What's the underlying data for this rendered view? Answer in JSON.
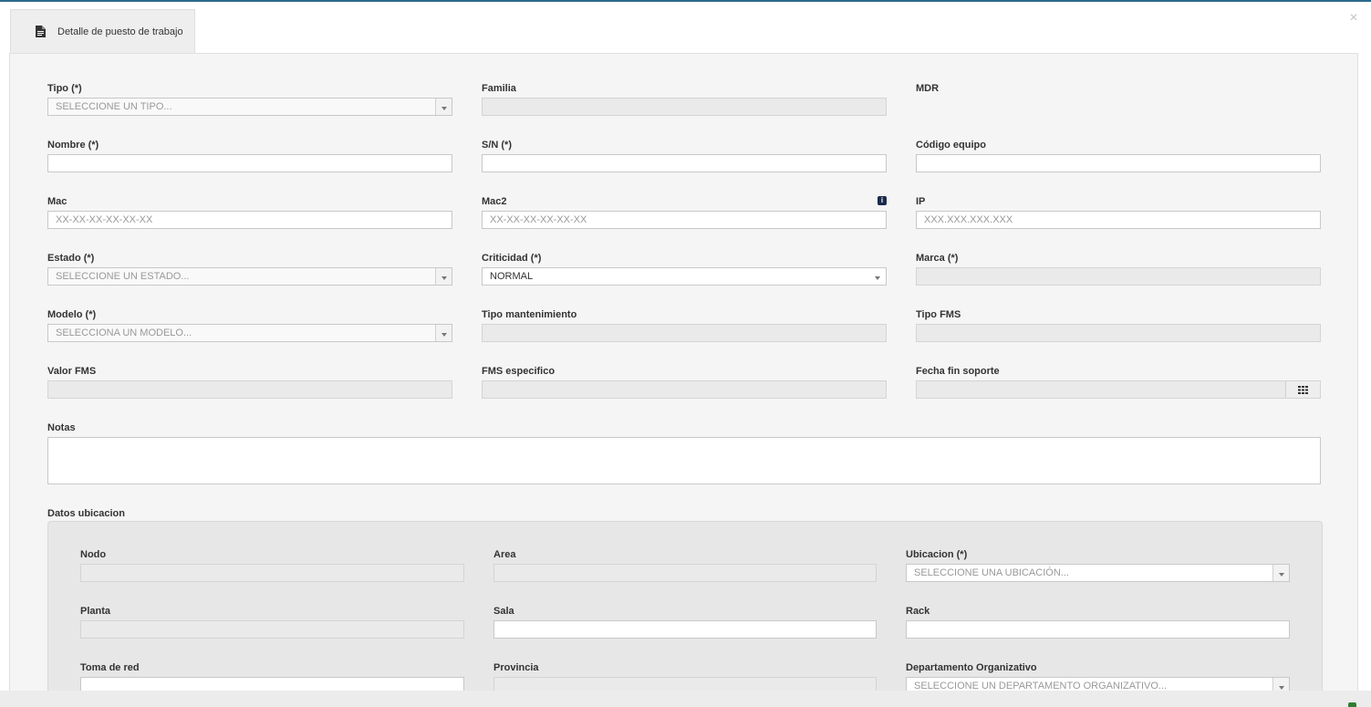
{
  "tab": {
    "title": "Detalle de puesto de trabajo",
    "icon": "document-icon"
  },
  "close": {
    "symbol": "×"
  },
  "fields": {
    "tipo": {
      "label": "Tipo (*)",
      "placeholder": "SELECCIONE UN TIPO..."
    },
    "familia": {
      "label": "Familia",
      "value": ""
    },
    "mdr": {
      "label": "MDR"
    },
    "nombre": {
      "label": "Nombre (*)",
      "value": ""
    },
    "sn": {
      "label": "S/N (*)",
      "value": ""
    },
    "codigo_equipo": {
      "label": "Código equipo",
      "value": ""
    },
    "mac": {
      "label": "Mac",
      "placeholder": "XX-XX-XX-XX-XX-XX"
    },
    "mac2": {
      "label": "Mac2",
      "placeholder": "XX-XX-XX-XX-XX-XX",
      "info": "i"
    },
    "ip": {
      "label": "IP",
      "placeholder": "XXX.XXX.XXX.XXX"
    },
    "estado": {
      "label": "Estado (*)",
      "placeholder": "SELECCIONE UN ESTADO..."
    },
    "criticidad": {
      "label": "Criticidad (*)",
      "value": "NORMAL"
    },
    "marca": {
      "label": "Marca (*)",
      "value": ""
    },
    "modelo": {
      "label": "Modelo (*)",
      "placeholder": "SELECCIONA UN MODELO..."
    },
    "tipo_mantenimiento": {
      "label": "Tipo mantenimiento",
      "value": ""
    },
    "tipo_fms": {
      "label": "Tipo FMS",
      "value": ""
    },
    "valor_fms": {
      "label": "Valor FMS",
      "value": ""
    },
    "fms_especifico": {
      "label": "FMS especifico",
      "value": ""
    },
    "fecha_fin_soporte": {
      "label": "Fecha fin soporte",
      "value": ""
    },
    "notas": {
      "label": "Notas",
      "value": ""
    }
  },
  "ubicacion": {
    "title": "Datos ubicacion",
    "nodo": {
      "label": "Nodo",
      "value": ""
    },
    "area": {
      "label": "Area",
      "value": ""
    },
    "ubicacion": {
      "label": "Ubicacion (*)",
      "placeholder": "SELECCIONE UNA UBICACIÓN..."
    },
    "planta": {
      "label": "Planta",
      "value": ""
    },
    "sala": {
      "label": "Sala",
      "value": ""
    },
    "rack": {
      "label": "Rack",
      "value": ""
    },
    "toma_red": {
      "label": "Toma de red",
      "value": ""
    },
    "provincia": {
      "label": "Provincia",
      "value": ""
    },
    "departamento": {
      "label": "Departamento Organizativo",
      "placeholder": "SELECCIONE UN DEPARTAMENTO ORGANIZATIVO..."
    }
  },
  "colors": {
    "accent": "#2a6a8c",
    "info_icon": "#1a2b4c",
    "status_dot": "#2e7d32"
  }
}
